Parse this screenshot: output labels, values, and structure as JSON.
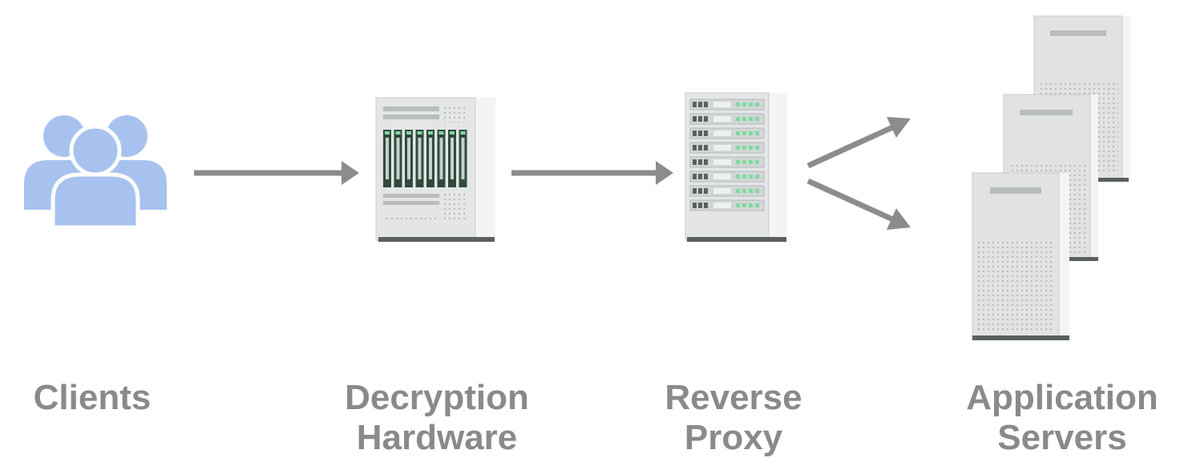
{
  "colors": {
    "label": "#8a8a8a",
    "arrow": "#8c8c8c",
    "clients_icon": "#a8c2ef",
    "device_body": "#e3e5e6",
    "device_side": "#f4f4f4",
    "device_dark": "#5a6061",
    "device_slot": "#2f4a3c",
    "indicator": "#7fd9a0"
  },
  "nodes": [
    {
      "id": "clients",
      "icon": "users-icon",
      "label_lines": [
        "Clients"
      ]
    },
    {
      "id": "decryption",
      "icon": "rack-server-icon",
      "label_lines": [
        "Decryption",
        "Hardware"
      ]
    },
    {
      "id": "proxy",
      "icon": "rack-server-icon",
      "label_lines": [
        "Reverse",
        "Proxy"
      ]
    },
    {
      "id": "servers",
      "icon": "tower-server-icon",
      "label_lines": [
        "Application",
        "Servers"
      ]
    }
  ]
}
